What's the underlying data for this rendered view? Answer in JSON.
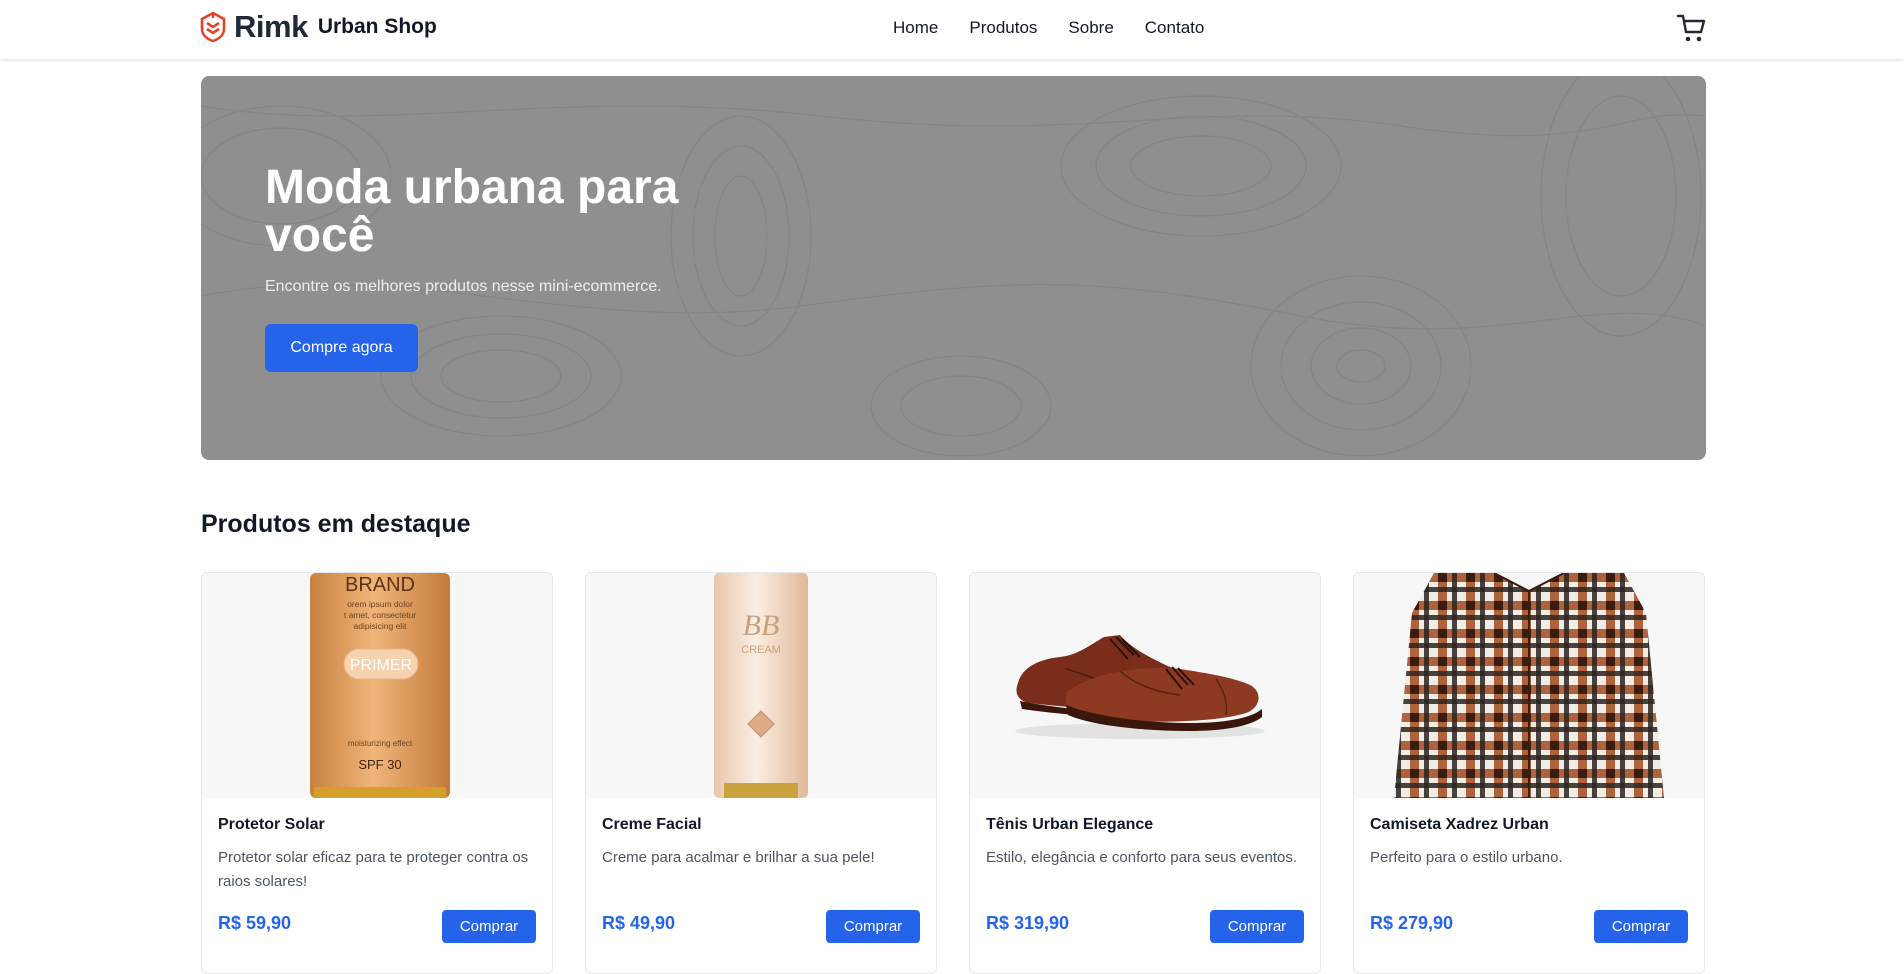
{
  "header": {
    "brand": "Rimk",
    "shop_name": "Urban Shop",
    "logo_icon": "layered-shield-logo",
    "cart_icon": "shopping-cart-icon",
    "nav": [
      {
        "label": "Home"
      },
      {
        "label": "Produtos"
      },
      {
        "label": "Sobre"
      },
      {
        "label": "Contato"
      }
    ]
  },
  "hero": {
    "title": "Moda urbana para você",
    "subtitle": "Encontre os melhores produtos nesse mini-ecommerce.",
    "cta": "Compre agora"
  },
  "featured": {
    "title": "Produtos em destaque",
    "products": [
      {
        "name": "Protetor Solar",
        "description": "Protetor solar eficaz para te proteger contra os raios solares!",
        "price": "R$ 59,90",
        "button": "Comprar",
        "image_text": {
          "brand": "BRAND",
          "lorem1": "orem ipsum dolor",
          "lorem2": "t amet, consectetur",
          "lorem3": "adipisicing elit",
          "label": "PRIMER",
          "effect": "moisturizing effect",
          "spf": "SPF 30"
        }
      },
      {
        "name": "Creme Facial",
        "description": "Creme para acalmar e brilhar a sua pele!",
        "price": "R$ 49,90",
        "button": "Comprar",
        "image_text": {
          "logo": "BB",
          "label": "CREAM"
        }
      },
      {
        "name": "Tênis Urban Elegance",
        "description": "Estilo, elegância e conforto para seus eventos.",
        "price": "R$ 319,90",
        "button": "Comprar"
      },
      {
        "name": "Camiseta Xadrez Urban",
        "description": "Perfeito para o estilo urbano.",
        "price": "R$ 279,90",
        "button": "Comprar"
      }
    ]
  },
  "colors": {
    "accent": "#2563eb",
    "hero_bg": "#8f8f8f",
    "logo": "#e4432a"
  }
}
